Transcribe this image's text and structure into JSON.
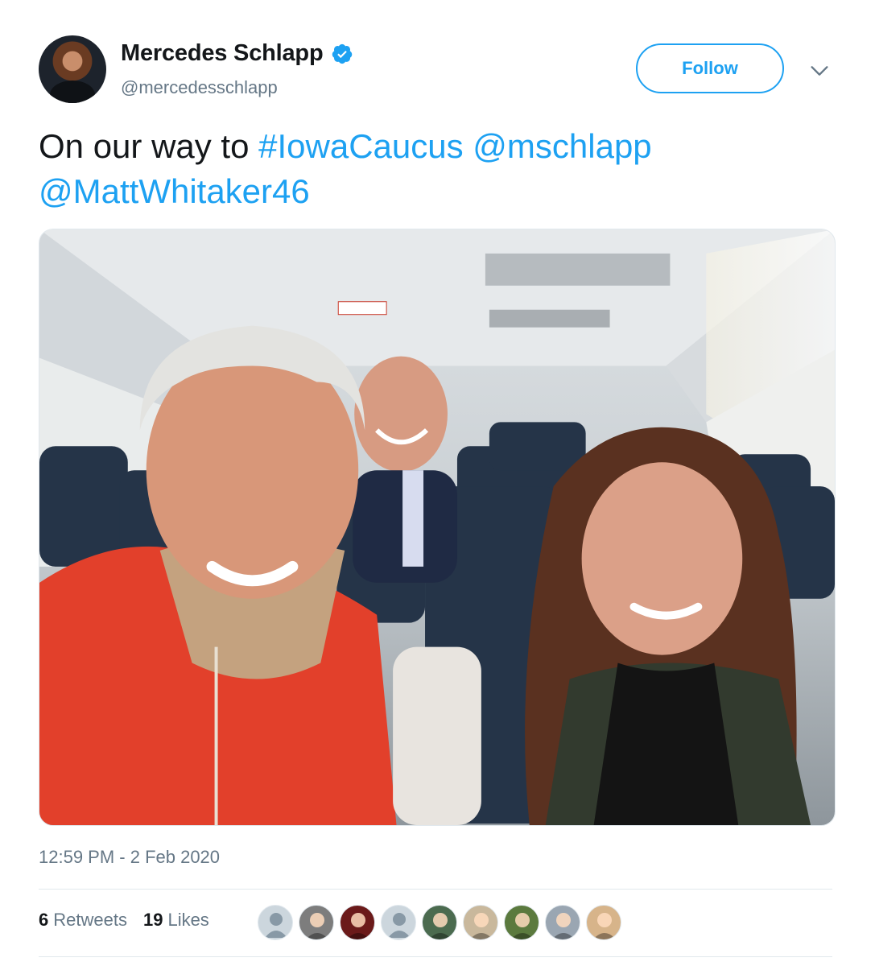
{
  "author": {
    "display_name": "Mercedes Schlapp",
    "handle": "@mercedesschlapp",
    "verified": true
  },
  "follow_button": {
    "label": "Follow"
  },
  "more_menu": {
    "icon": "chevron-down-icon"
  },
  "tweet": {
    "text_prefix": "On our way to ",
    "hashtag": "#IowaCaucus",
    "mention_1": "@mschlapp",
    "mention_2": "@MattWhitaker46"
  },
  "media": {
    "image": "selfie-on-airplane"
  },
  "timestamp": "12:59 PM - 2 Feb 2020",
  "stats": {
    "retweets_count": "6",
    "retweets_label": "Retweets",
    "likes_count": "19",
    "likes_label": "Likes"
  },
  "likers": [
    {
      "type": "default-avatar-icon",
      "bg": "#ccd6dd"
    },
    {
      "type": "photo",
      "bg": "#7d7d7d"
    },
    {
      "type": "photo",
      "bg": "#6b1a1a"
    },
    {
      "type": "default-avatar-icon",
      "bg": "#ccd6dd"
    },
    {
      "type": "photo",
      "bg": "#4b6b4f"
    },
    {
      "type": "photo",
      "bg": "#c9b89c"
    },
    {
      "type": "photo",
      "bg": "#5b7a3e"
    },
    {
      "type": "photo",
      "bg": "#9aa6b2"
    },
    {
      "type": "photo",
      "bg": "#d7b48a"
    }
  ],
  "colors": {
    "accent": "#1da1f2",
    "muted": "#657786",
    "text": "#14171a"
  }
}
